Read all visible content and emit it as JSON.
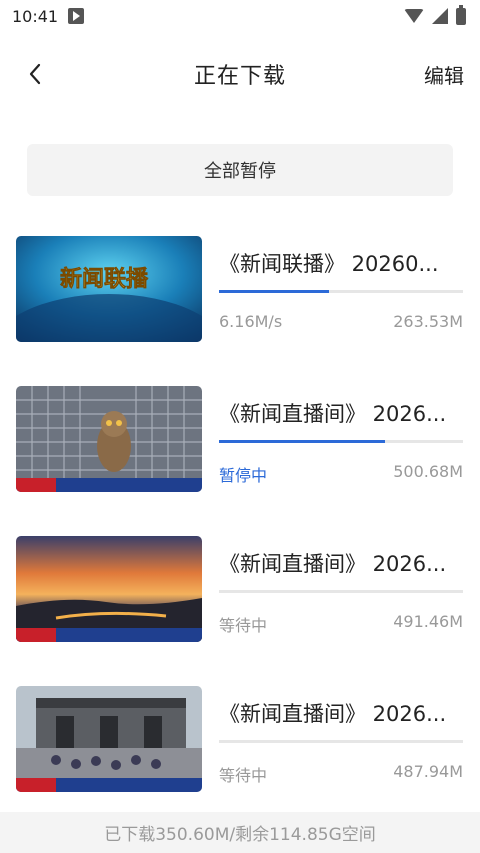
{
  "status_bar": {
    "time": "10:41"
  },
  "nav": {
    "title": "正在下载",
    "edit_label": "编辑"
  },
  "pause_all_label": "全部暂停",
  "downloads": [
    {
      "title": "《新闻联播》 20260...",
      "status": "6.16M/s",
      "size": "263.53M",
      "progress": 0.45,
      "state": "downloading",
      "thumb_overlay": "新闻联播"
    },
    {
      "title": "《新闻直播间》 2026...",
      "status": "暂停中",
      "size": "500.68M",
      "progress": 0.68,
      "state": "paused"
    },
    {
      "title": "《新闻直播间》 2026...",
      "status": "等待中",
      "size": "491.46M",
      "progress": 0,
      "state": "waiting"
    },
    {
      "title": "《新闻直播间》 2026...",
      "status": "等待中",
      "size": "487.94M",
      "progress": 0,
      "state": "waiting"
    }
  ],
  "footer": {
    "storage_text": "已下载350.60M/剩余114.85G空间"
  },
  "colors": {
    "accent": "#2c6ad8",
    "muted": "#999999"
  }
}
